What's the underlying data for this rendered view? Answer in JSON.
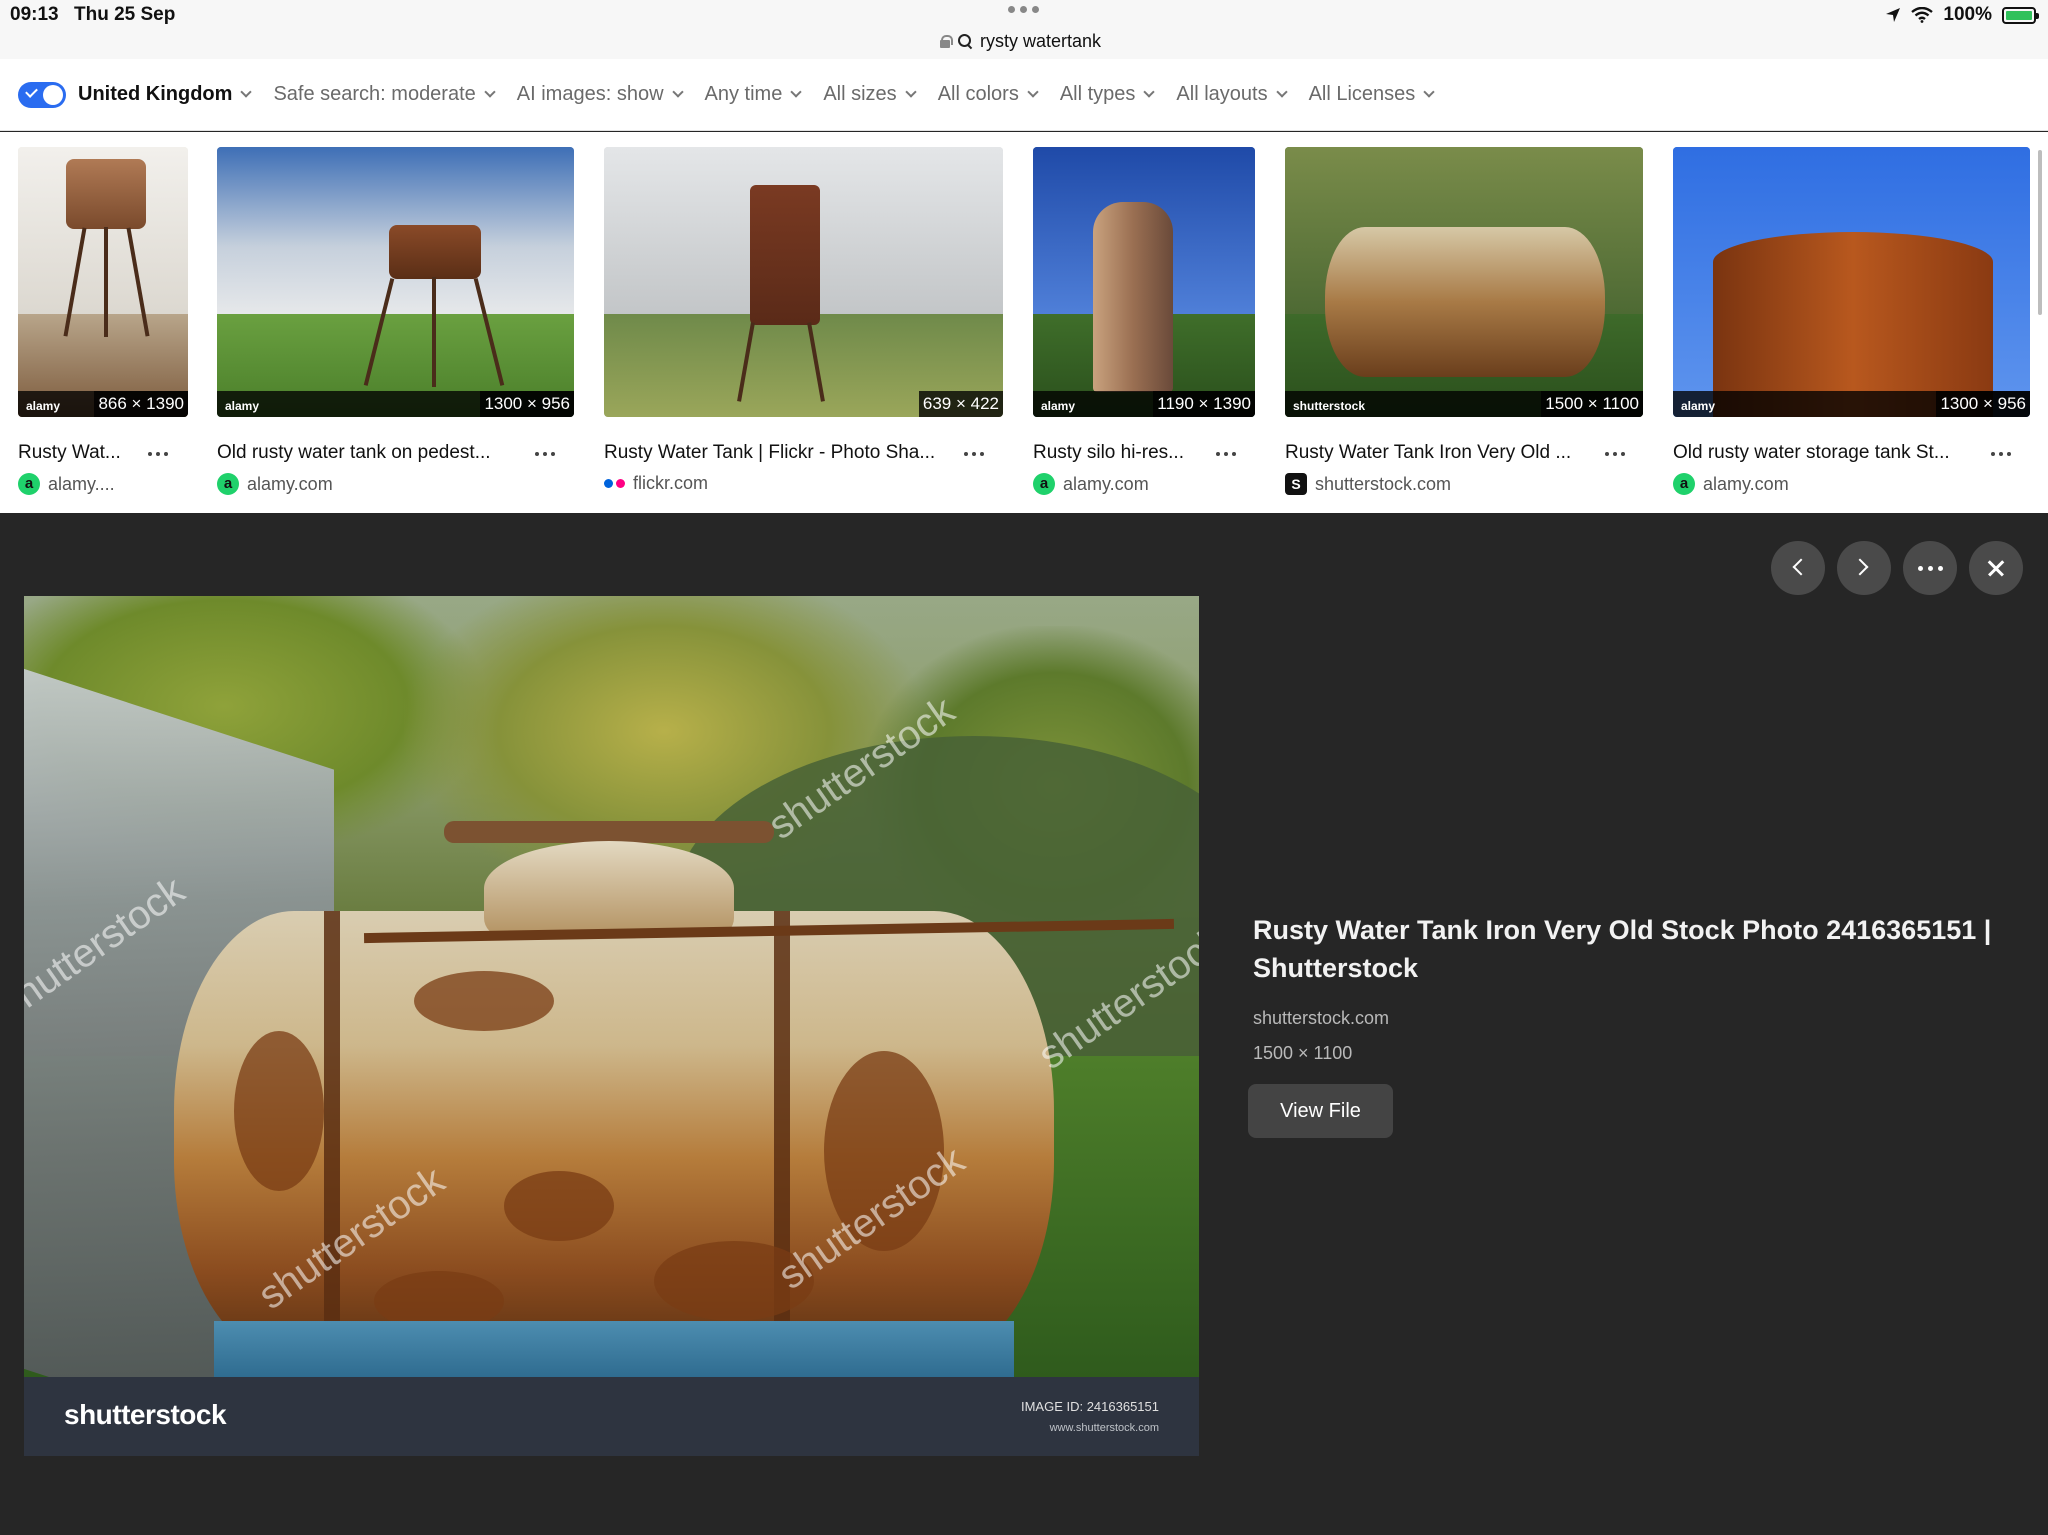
{
  "status_bar": {
    "time": "09:13",
    "date": "Thu 25 Sep",
    "url": "rysty watertank",
    "battery": "100%"
  },
  "filters": {
    "region": "United Kingdom",
    "items": [
      "Safe search: moderate",
      "AI images: show",
      "Any time",
      "All sizes",
      "All colors",
      "All types",
      "All layouts",
      "All Licenses"
    ]
  },
  "thumbnails": [
    {
      "title": "Rusty Wat...",
      "source": "alamy....",
      "source_icon": "alamy-icon",
      "dims": "866 × 1390"
    },
    {
      "title": "Old rusty water tank on pedest...",
      "source": "alamy.com",
      "source_icon": "alamy-icon",
      "dims": "1300 × 956"
    },
    {
      "title": "Rusty Water Tank | Flickr - Photo Sha...",
      "source": "flickr.com",
      "source_icon": "flickr-icon",
      "dims": "639 × 422"
    },
    {
      "title": "Rusty silo hi-res...",
      "source": "alamy.com",
      "source_icon": "alamy-icon",
      "dims": "1190 × 1390"
    },
    {
      "title": "Rusty Water Tank Iron Very Old ...",
      "source": "shutterstock.com",
      "source_icon": "shutterstock-icon",
      "dims": "1500 × 1100"
    },
    {
      "title": "Old rusty water storage tank St...",
      "source": "alamy.com",
      "source_icon": "alamy-icon",
      "dims": "1300 × 956"
    }
  ],
  "thumb_watermarks": {
    "alamy": "alamy",
    "shutterstock": "shutterstock"
  },
  "viewer": {
    "image_watermark": "shutterstock",
    "footer_logo": "shutterstock",
    "image_id": "IMAGE ID: 2416365151",
    "footer_url": "www.shutterstock.com",
    "title": "Rusty Water Tank Iron Very Old Stock Photo 2416365151 | Shutterstock",
    "source": "shutterstock.com",
    "dims": "1500 × 1100",
    "view_file_label": "View File"
  },
  "colors": {
    "accent": "#2a6cf0",
    "viewer_bg": "#262626",
    "alamy_green": "#1fd16b"
  }
}
